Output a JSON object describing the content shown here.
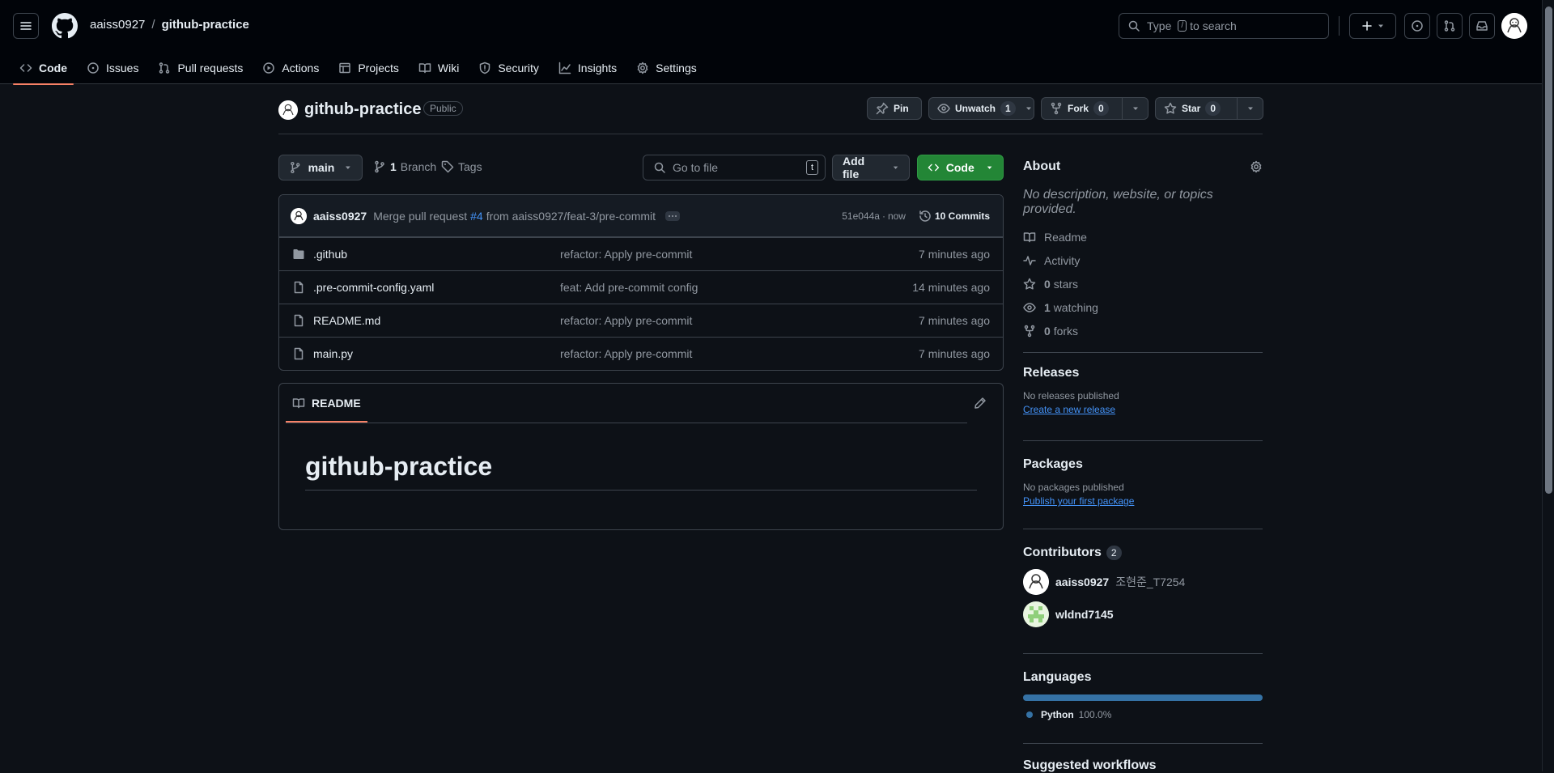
{
  "header": {
    "owner": "aaiss0927",
    "separator": "/",
    "repo": "github-practice",
    "search_placeholder_pre": "Type",
    "search_key": "/",
    "search_placeholder_post": "to search"
  },
  "tabs": [
    {
      "label": "Code",
      "icon": "code-icon"
    },
    {
      "label": "Issues",
      "icon": "issue-icon"
    },
    {
      "label": "Pull requests",
      "icon": "pull-request-icon"
    },
    {
      "label": "Actions",
      "icon": "play-icon"
    },
    {
      "label": "Projects",
      "icon": "table-icon"
    },
    {
      "label": "Wiki",
      "icon": "book-icon"
    },
    {
      "label": "Security",
      "icon": "shield-icon"
    },
    {
      "label": "Insights",
      "icon": "graph-icon"
    },
    {
      "label": "Settings",
      "icon": "gear-icon"
    }
  ],
  "repo": {
    "name": "github-practice",
    "visibility": "Public",
    "pin_label": "Pin",
    "unwatch_label": "Unwatch",
    "watch_count": "1",
    "fork_label": "Fork",
    "fork_count": "0",
    "star_label": "Star",
    "star_count": "0"
  },
  "toolbar": {
    "branch": "main",
    "branch_count": "1",
    "branch_label": "Branch",
    "tags_label": "Tags",
    "go_to_file": "Go to file",
    "go_to_file_key": "t",
    "add_file": "Add file",
    "code": "Code"
  },
  "commit": {
    "author": "aaiss0927",
    "message_pre": "Merge pull request",
    "pr_ref": "#4",
    "message_post": "from aaiss0927/feat-3/pre-commit",
    "sha": "51e044a",
    "dot": "·",
    "time": "now",
    "commits_label": "10 Commits"
  },
  "files": [
    {
      "name": ".github",
      "type": "folder",
      "message": "refactor: Apply pre-commit",
      "date": "7 minutes ago"
    },
    {
      "name": ".pre-commit-config.yaml",
      "type": "file",
      "message": "feat: Add pre-commit config",
      "date": "14 minutes ago"
    },
    {
      "name": "README.md",
      "type": "file",
      "message": "refactor: Apply pre-commit",
      "date": "7 minutes ago"
    },
    {
      "name": "main.py",
      "type": "file",
      "message": "refactor: Apply pre-commit",
      "date": "7 minutes ago"
    }
  ],
  "readme": {
    "tab_label": "README",
    "heading": "github-practice"
  },
  "about": {
    "title": "About",
    "description": "No description, website, or topics provided.",
    "readme": "Readme",
    "activity": "Activity",
    "stars_count": "0",
    "stars_label": "stars",
    "watching_count": "1",
    "watching_label": "watching",
    "forks_count": "0",
    "forks_label": "forks"
  },
  "releases": {
    "title": "Releases",
    "empty": "No releases published",
    "link": "Create a new release"
  },
  "packages": {
    "title": "Packages",
    "empty": "No packages published",
    "link": "Publish your first package"
  },
  "contributors": {
    "title": "Contributors",
    "count": "2",
    "people": [
      {
        "login": "aaiss0927",
        "name": "조현준_T7254"
      },
      {
        "login": "wldnd7145",
        "name": ""
      }
    ]
  },
  "languages": {
    "title": "Languages",
    "items": [
      {
        "name": "Python",
        "percent": "100.0%",
        "color": "#3572A5",
        "fraction": 1.0
      }
    ]
  },
  "suggested": {
    "title": "Suggested workflows"
  },
  "colors": {
    "accent_green": "#238636",
    "tab_underline": "#f78166",
    "link_blue": "#4493f8"
  }
}
